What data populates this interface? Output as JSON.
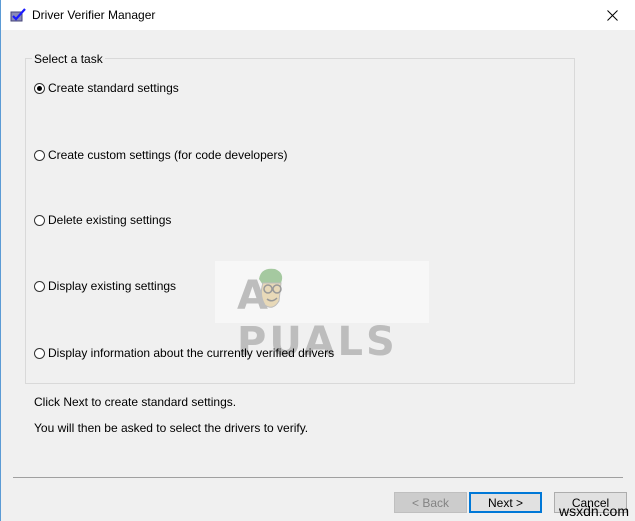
{
  "window": {
    "title": "Driver Verifier Manager",
    "icon": "driver-verifier-checkbox-icon",
    "close_icon": "close-icon"
  },
  "task_group": {
    "legend": "Select a task",
    "options": [
      {
        "label": "Create standard settings",
        "checked": true
      },
      {
        "label": "Create custom settings (for code developers)",
        "checked": false
      },
      {
        "label": "Delete existing settings",
        "checked": false
      },
      {
        "label": "Display existing settings",
        "checked": false
      },
      {
        "label": "Display information about the currently verified drivers",
        "checked": false
      }
    ]
  },
  "info": {
    "line1": "Click Next to create standard settings.",
    "line2": "You will then be asked to select the drivers to verify."
  },
  "watermark": {
    "text": "A PUALS"
  },
  "buttons": {
    "back": "< Back",
    "next": "Next >",
    "cancel": "Cancel"
  },
  "footer_watermark": "wsxdn.com"
}
